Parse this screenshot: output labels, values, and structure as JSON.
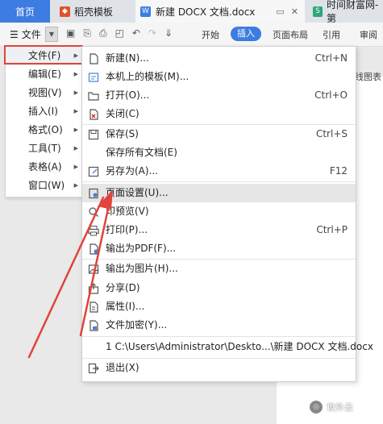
{
  "tabs": {
    "home": "首页",
    "template": "稻壳模板",
    "document": "新建 DOCX 文档.docx",
    "finance": "时间财富网-第"
  },
  "toolbar": {
    "file_label": "文件",
    "tabs": [
      "开始",
      "插入",
      "页面布局",
      "引用",
      "审阅"
    ],
    "active_tab": "插入"
  },
  "left_menu": {
    "items": [
      "文件(F)",
      "编辑(E)",
      "视图(V)",
      "插入(I)",
      "格式(O)",
      "工具(T)",
      "表格(A)",
      "窗口(W)"
    ]
  },
  "file_menu": {
    "items": [
      {
        "label": "新建(N)...",
        "shortcut": "Ctrl+N",
        "icon": "new-doc-icon"
      },
      {
        "label": "本机上的模板(M)...",
        "shortcut": "",
        "icon": "template-icon"
      },
      {
        "label": "打开(O)...",
        "shortcut": "Ctrl+O",
        "icon": "open-folder-icon"
      },
      {
        "label": "关闭(C)",
        "shortcut": "",
        "icon": "close-doc-icon"
      },
      {
        "label": "保存(S)",
        "shortcut": "Ctrl+S",
        "icon": "save-icon"
      },
      {
        "label": "保存所有文档(E)",
        "shortcut": "",
        "icon": ""
      },
      {
        "label": "另存为(A)...",
        "shortcut": "F12",
        "icon": "save-as-icon"
      },
      {
        "label": "页面设置(U)...",
        "shortcut": "",
        "icon": "page-setup-icon"
      },
      {
        "label": "印预览(V)",
        "shortcut": "",
        "icon": "print-preview-icon"
      },
      {
        "label": "打印(P)...",
        "shortcut": "Ctrl+P",
        "icon": "print-icon"
      },
      {
        "label": "输出为PDF(F)...",
        "shortcut": "",
        "icon": "export-pdf-icon"
      },
      {
        "label": "输出为图片(H)...",
        "shortcut": "",
        "icon": "export-image-icon"
      },
      {
        "label": "分享(D)",
        "shortcut": "",
        "icon": "share-icon"
      },
      {
        "label": "属性(I)...",
        "shortcut": "",
        "icon": "properties-icon"
      },
      {
        "label": "文件加密(Y)...",
        "shortcut": "",
        "icon": "encrypt-icon"
      },
      {
        "label": "1 C:\\Users\\Administrator\\Deskto...\\新建 DOCX 文档.docx",
        "shortcut": "",
        "icon": ""
      },
      {
        "label": "退出(X)",
        "shortcut": "",
        "icon": "exit-icon"
      }
    ]
  },
  "doc": {
    "snippet": "线图表"
  },
  "watermark": {
    "text": "世外云"
  },
  "colors": {
    "accent": "#3d7ce0",
    "highlight_box": "#e0443a",
    "arrow": "#e0443a"
  }
}
